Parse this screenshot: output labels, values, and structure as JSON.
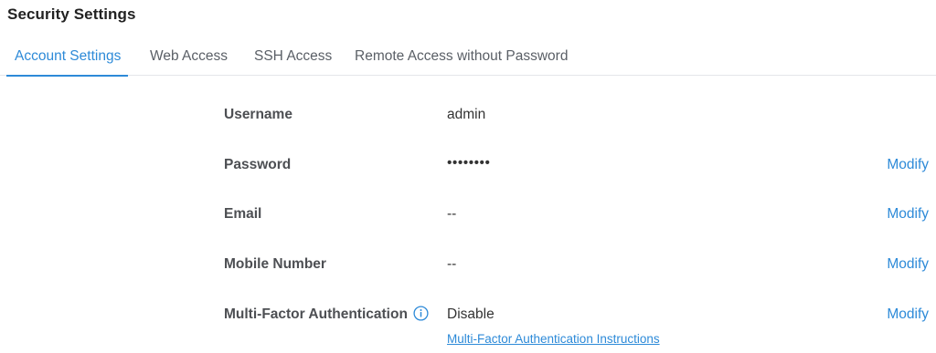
{
  "page": {
    "title": "Security Settings"
  },
  "tabs": [
    {
      "label": "Account Settings",
      "active": true
    },
    {
      "label": "Web Access",
      "active": false
    },
    {
      "label": "SSH Access",
      "active": false
    },
    {
      "label": "Remote Access without Password",
      "active": false
    }
  ],
  "rows": {
    "username": {
      "label": "Username",
      "value": "admin"
    },
    "password": {
      "label": "Password",
      "value": "••••••••",
      "action": "Modify"
    },
    "email": {
      "label": "Email",
      "value": "--",
      "action": "Modify"
    },
    "mobile": {
      "label": "Mobile Number",
      "value": "--",
      "action": "Modify"
    },
    "mfa": {
      "label": "Multi-Factor Authentication",
      "icon": "info-icon",
      "value": "Disable",
      "action": "Modify",
      "link": "Multi-Factor Authentication Instructions"
    }
  },
  "colors": {
    "accent": "#2d8ad8",
    "label": "#4d4f53",
    "tab_inactive": "#5a5f66",
    "divider": "#e4e6ea"
  }
}
